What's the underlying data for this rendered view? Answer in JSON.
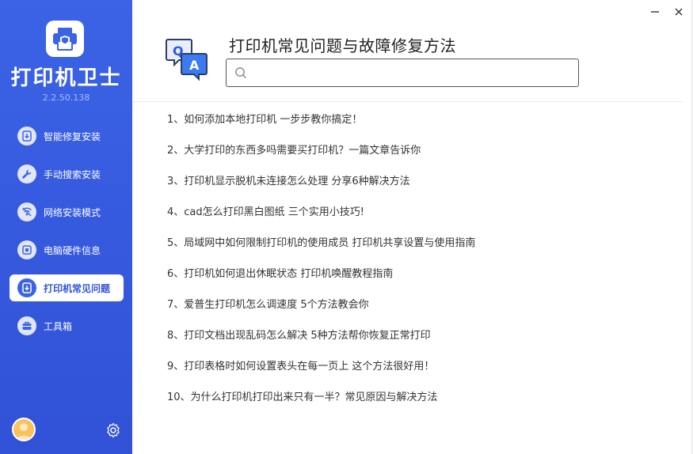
{
  "app": {
    "title": "打印机卫士",
    "version": "2.2.50.138"
  },
  "sidebar": {
    "items": [
      {
        "label": "智能修复安装",
        "icon": "download-install-icon",
        "active": false
      },
      {
        "label": "手动搜索安装",
        "icon": "wrench-icon",
        "active": false
      },
      {
        "label": "网络安装模式",
        "icon": "wifi-icon",
        "active": false
      },
      {
        "label": "电脑硬件信息",
        "icon": "hardware-icon",
        "active": false
      },
      {
        "label": "打印机常见问题",
        "icon": "printer-faq-icon",
        "active": true
      },
      {
        "label": "工具箱",
        "icon": "toolbox-icon",
        "active": false
      }
    ]
  },
  "header": {
    "title": "打印机常见问题与故障修复方法"
  },
  "search": {
    "value": "",
    "placeholder": ""
  },
  "faq": {
    "items": [
      "1、如何添加本地打印机 一步步教你搞定！",
      "2、大学打印的东西多吗需要买打印机？一篇文章告诉你",
      "3、打印机显示脱机未连接怎么处理 分享6种解决方法",
      "4、cad怎么打印黑白图纸 三个实用小技巧!",
      "5、局域网中如何限制打印机的使用成员 打印机共享设置与使用指南",
      "6、打印机如何退出休眠状态 打印机唤醒教程指南",
      "7、爱普生打印机怎么调速度 5个方法教会你",
      "8、打印文档出现乱码怎么解决 5种方法帮你恢复正常打印",
      "9、打印表格时如何设置表头在每一页上 这个方法很好用！",
      "10、为什么打印机打印出来只有一半？常见原因与解决方法"
    ]
  },
  "colors": {
    "sidebar_bg": "#3b63e6",
    "active_text": "#2f54d8",
    "accent": "#3b63e6"
  }
}
